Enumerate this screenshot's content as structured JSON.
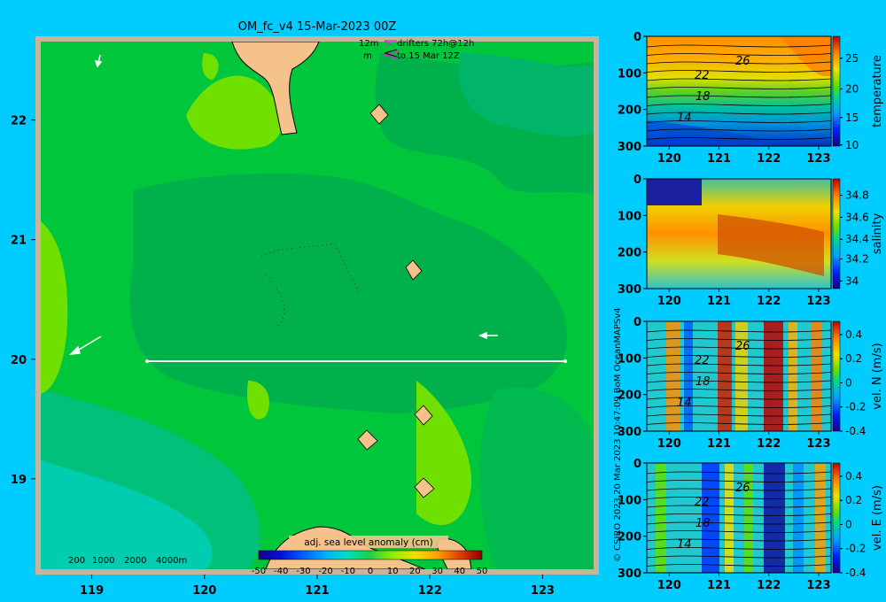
{
  "map": {
    "title": "OM_fc_v4  15-Mar-2023 00Z",
    "drifter_note_line1": "12m",
    "drifter_note_line2": "m",
    "drifter_label_line1": "drifters 72h@12h",
    "drifter_label_line2": "to 15 Mar 12Z",
    "depth_legend": [
      "200",
      "1000",
      "2000",
      "4000m"
    ],
    "lon_ticks": [
      "119",
      "120",
      "121",
      "122",
      "123"
    ],
    "lat_ticks": [
      "22",
      "21",
      "20",
      "19"
    ],
    "colorbar_label": "adj. sea level anomaly (cm)",
    "colorbar_ticks": [
      "-50",
      "-40",
      "-30",
      "-20",
      "-10",
      "0",
      "10",
      "20",
      "30",
      "40",
      "50"
    ],
    "section_line_lat": 20.0,
    "section_line_lon_start": 119.5,
    "section_line_lon_end": 123.2
  },
  "credit": "© CSIRO 2023   20 Mar 2023 10:47:09 BoM OceanMAPSv4",
  "panels": [
    {
      "id": "temperature",
      "label": "temperature",
      "cb_ticks": [
        "25",
        "20",
        "15",
        "10"
      ],
      "y_ticks": [
        "0",
        "100",
        "200",
        "300"
      ],
      "x_ticks": [
        "120",
        "121",
        "122",
        "123"
      ],
      "contour_labels": [
        "26",
        "22",
        "18",
        "14"
      ]
    },
    {
      "id": "salinity",
      "label": "salinity",
      "cb_ticks": [
        "34.8",
        "34.6",
        "34.4",
        "34.2",
        "34"
      ],
      "y_ticks": [
        "0",
        "100",
        "200",
        "300"
      ],
      "x_ticks": [
        "120",
        "121",
        "122",
        "123"
      ],
      "contour_labels": []
    },
    {
      "id": "veln",
      "label": "vel. N (m/s)",
      "cb_ticks": [
        "0.4",
        "0.2",
        "0",
        "-0.2",
        "-0.4"
      ],
      "y_ticks": [
        "0",
        "100",
        "200",
        "300"
      ],
      "x_ticks": [
        "120",
        "121",
        "122",
        "123"
      ],
      "contour_labels": [
        "26",
        "22",
        "18",
        "14"
      ]
    },
    {
      "id": "vele",
      "label": "vel. E (m/s)",
      "cb_ticks": [
        "0.4",
        "0.2",
        "0",
        "-0.2",
        "-0.4"
      ],
      "y_ticks": [
        "0",
        "100",
        "200",
        "300"
      ],
      "x_ticks": [
        "120",
        "121",
        "122",
        "123"
      ],
      "contour_labels": [
        "26",
        "22",
        "18",
        "14"
      ]
    }
  ]
}
